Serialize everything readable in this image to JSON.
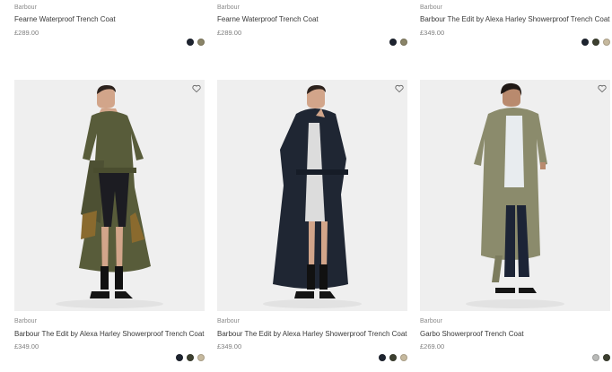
{
  "top_row": [
    {
      "brand": "Barbour",
      "name": "Fearne Waterproof Trench Coat",
      "price": "£289.00",
      "swatches": [
        "#1e2430",
        "#8a8468"
      ]
    },
    {
      "brand": "Barbour",
      "name": "Fearne Waterproof Trench Coat",
      "price": "£289.00",
      "swatches": [
        "#1e2430",
        "#8a8468"
      ]
    },
    {
      "brand": "Barbour",
      "name": "Barbour The Edit by Alexa Harley Showerproof Trench Coat",
      "price": "£349.00",
      "swatches": [
        "#1e2430",
        "#3d4030",
        "#c6b99e"
      ]
    }
  ],
  "bottom_row": [
    {
      "brand": "Barbour",
      "name": "Barbour The Edit by Alexa Harley Showerproof Trench Coat",
      "price": "£349.00",
      "swatches": [
        "#1e2430",
        "#3d4030",
        "#c6b99e"
      ],
      "image": "woman-in-olive-belted-trench-coat"
    },
    {
      "brand": "Barbour",
      "name": "Barbour The Edit by Alexa Harley Showerproof Trench Coat",
      "price": "£349.00",
      "swatches": [
        "#1e2430",
        "#3d4030",
        "#c6b99e"
      ],
      "image": "woman-in-navy-belted-trench-coat"
    },
    {
      "brand": "Barbour",
      "name": "Garbo Showerproof Trench Coat",
      "price": "£269.00",
      "swatches": [
        "#b9bab8",
        "#3d4030"
      ],
      "image": "woman-in-khaki-trench-coat"
    }
  ],
  "icons": {
    "wishlist": "heart-outline-icon"
  }
}
